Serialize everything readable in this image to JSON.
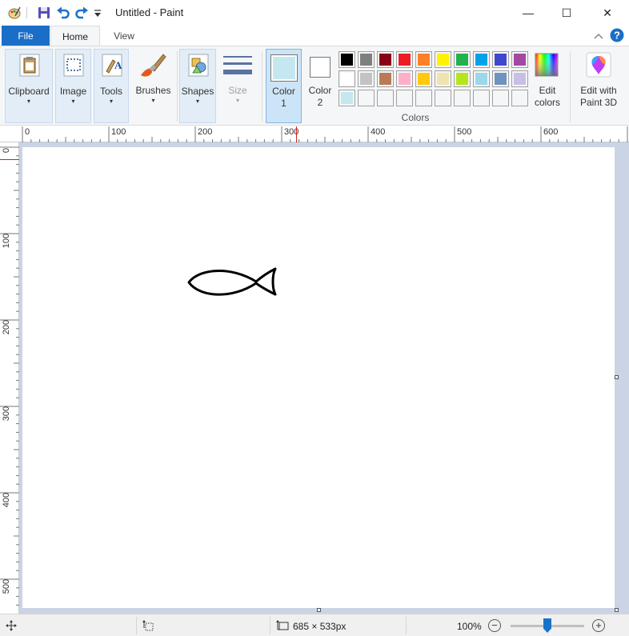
{
  "window": {
    "title": "Untitled - Paint",
    "minimize_glyph": "—",
    "maximize_glyph": "☐",
    "close_glyph": "✕"
  },
  "tabs": {
    "file": "File",
    "home": "Home",
    "view": "View"
  },
  "ribbon": {
    "clipboard": "Clipboard",
    "image": "Image",
    "tools": "Tools",
    "brushes": "Brushes",
    "shapes": "Shapes",
    "size": "Size",
    "color1_line1": "Color",
    "color1_line2": "1",
    "color2_line1": "Color",
    "color2_line2": "2",
    "colors_group": "Colors",
    "edit_colors_line1": "Edit",
    "edit_colors_line2": "colors",
    "paint3d_line1": "Edit with",
    "paint3d_line2": "Paint 3D",
    "caret": "▾",
    "color1_value": "#c5e8f0",
    "color2_value": "#ffffff"
  },
  "palette": [
    "#000000",
    "#7f7f7f",
    "#880015",
    "#ed1c24",
    "#ff7f27",
    "#fff200",
    "#22b14c",
    "#00a2e8",
    "#3f48cc",
    "#a349a4",
    "#ffffff",
    "#c3c3c3",
    "#b97a57",
    "#ffaec9",
    "#ffc90e",
    "#efe4b0",
    "#b5e61d",
    "#99d9ea",
    "#7092be",
    "#c8bfe7",
    "#c5e8f0",
    "#f5f6f7",
    "#f5f6f7",
    "#f5f6f7",
    "#f5f6f7",
    "#f5f6f7",
    "#f5f6f7",
    "#f5f6f7",
    "#f5f6f7",
    "#f5f6f7"
  ],
  "rulers": {
    "h_labels": [
      "0",
      "100",
      "200",
      "300",
      "400",
      "500",
      "600"
    ],
    "v_labels": [
      "0",
      "100",
      "200",
      "300",
      "400",
      "500"
    ]
  },
  "status": {
    "dimensions": "685 × 533px",
    "zoom": "100%",
    "zoom_out": "−",
    "zoom_in": "+"
  },
  "colors": {
    "accent": "#1a6ec8",
    "workspace": "#cbd4e4",
    "ruler_marker": "#d02020"
  }
}
